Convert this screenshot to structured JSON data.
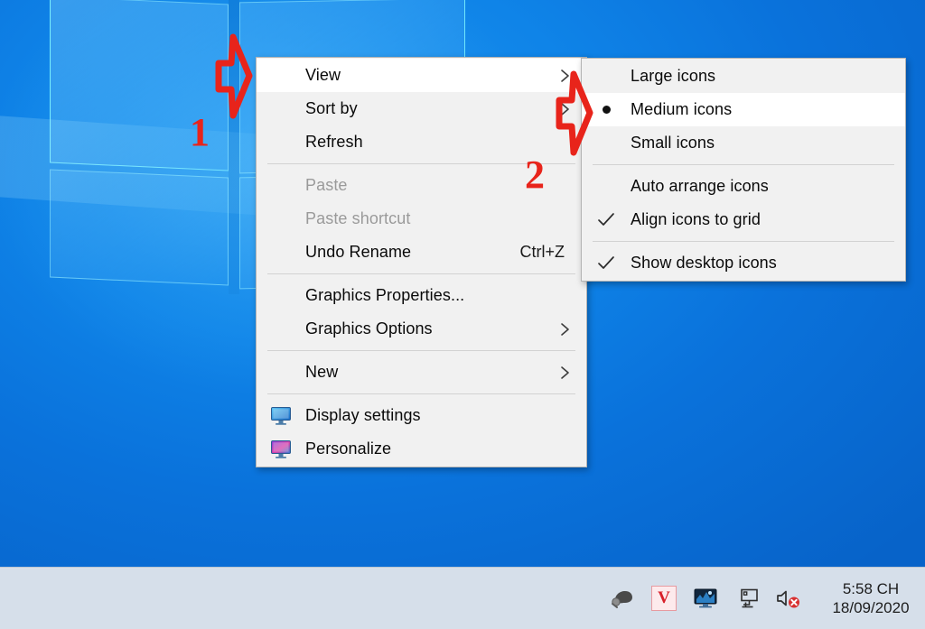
{
  "desktop": {
    "wallpaper_name": "windows-10-hero-wallpaper",
    "background_color": "#0a72d8"
  },
  "context_menu": {
    "name": "desktop-context-menu",
    "items": [
      {
        "id": "view",
        "label": "View",
        "submenu": true,
        "disabled": false,
        "highlighted": true,
        "accel": "",
        "icon": ""
      },
      {
        "id": "sort-by",
        "label": "Sort by",
        "submenu": true,
        "disabled": false,
        "highlighted": false,
        "accel": "",
        "icon": ""
      },
      {
        "id": "refresh",
        "label": "Refresh",
        "submenu": false,
        "disabled": false,
        "highlighted": false,
        "accel": "",
        "icon": ""
      },
      {
        "id": "separator-1",
        "label": "",
        "separator": true
      },
      {
        "id": "paste",
        "label": "Paste",
        "submenu": false,
        "disabled": true,
        "highlighted": false,
        "accel": "",
        "icon": ""
      },
      {
        "id": "paste-shortcut",
        "label": "Paste shortcut",
        "submenu": false,
        "disabled": true,
        "highlighted": false,
        "accel": "",
        "icon": ""
      },
      {
        "id": "undo-rename",
        "label": "Undo Rename",
        "submenu": false,
        "disabled": false,
        "highlighted": false,
        "accel": "Ctrl+Z",
        "icon": ""
      },
      {
        "id": "separator-2",
        "label": "",
        "separator": true
      },
      {
        "id": "graphics-properties",
        "label": "Graphics Properties...",
        "submenu": false,
        "disabled": false,
        "highlighted": false,
        "accel": "",
        "icon": ""
      },
      {
        "id": "graphics-options",
        "label": "Graphics Options",
        "submenu": true,
        "disabled": false,
        "highlighted": false,
        "accel": "",
        "icon": ""
      },
      {
        "id": "separator-3",
        "label": "",
        "separator": true
      },
      {
        "id": "new",
        "label": "New",
        "submenu": true,
        "disabled": false,
        "highlighted": false,
        "accel": "",
        "icon": ""
      },
      {
        "id": "separator-4",
        "label": "",
        "separator": true
      },
      {
        "id": "display-settings",
        "label": "Display settings",
        "submenu": false,
        "disabled": false,
        "highlighted": false,
        "accel": "",
        "icon": "monitor-icon"
      },
      {
        "id": "personalize",
        "label": "Personalize",
        "submenu": false,
        "disabled": false,
        "highlighted": false,
        "accel": "",
        "icon": "monitor-paint-icon"
      }
    ]
  },
  "view_submenu": {
    "name": "view-submenu",
    "items": [
      {
        "id": "large-icons",
        "label": "Large icons",
        "mark": "",
        "separator": false,
        "highlighted": false
      },
      {
        "id": "medium-icons",
        "label": "Medium icons",
        "mark": "radio",
        "separator": false,
        "highlighted": true
      },
      {
        "id": "small-icons",
        "label": "Small icons",
        "mark": "",
        "separator": false,
        "highlighted": false
      },
      {
        "id": "separator-1",
        "label": "",
        "separator": true
      },
      {
        "id": "auto-arrange-icons",
        "label": "Auto arrange icons",
        "mark": "",
        "separator": false,
        "highlighted": false
      },
      {
        "id": "align-icons-to-grid",
        "label": "Align icons to grid",
        "mark": "check",
        "separator": false,
        "highlighted": false
      },
      {
        "id": "separator-2",
        "label": "",
        "separator": true
      },
      {
        "id": "show-desktop-icons",
        "label": "Show desktop icons",
        "mark": "check",
        "separator": false,
        "highlighted": false
      }
    ]
  },
  "annotations": {
    "color": "#e8241b",
    "markers": [
      {
        "id": "marker-1",
        "number": "1",
        "arrow": "right-arrow-outline",
        "points_at": "view"
      },
      {
        "id": "marker-2",
        "number": "2",
        "arrow": "right-arrow-outline",
        "points_at": "view-submenu"
      }
    ]
  },
  "taskbar": {
    "tray_icons": [
      {
        "id": "audio-horn",
        "name": "speaker-horn-icon",
        "label": ""
      },
      {
        "id": "unikey",
        "name": "unikey-v-icon",
        "label": "V"
      },
      {
        "id": "display-util",
        "name": "monitor-icon",
        "label": ""
      },
      {
        "id": "network",
        "name": "network-monitor-icon",
        "label": ""
      },
      {
        "id": "volume-muted",
        "name": "volume-muted-icon",
        "label": ""
      }
    ],
    "clock": {
      "time": "5:58 CH",
      "date": "18/09/2020"
    }
  }
}
